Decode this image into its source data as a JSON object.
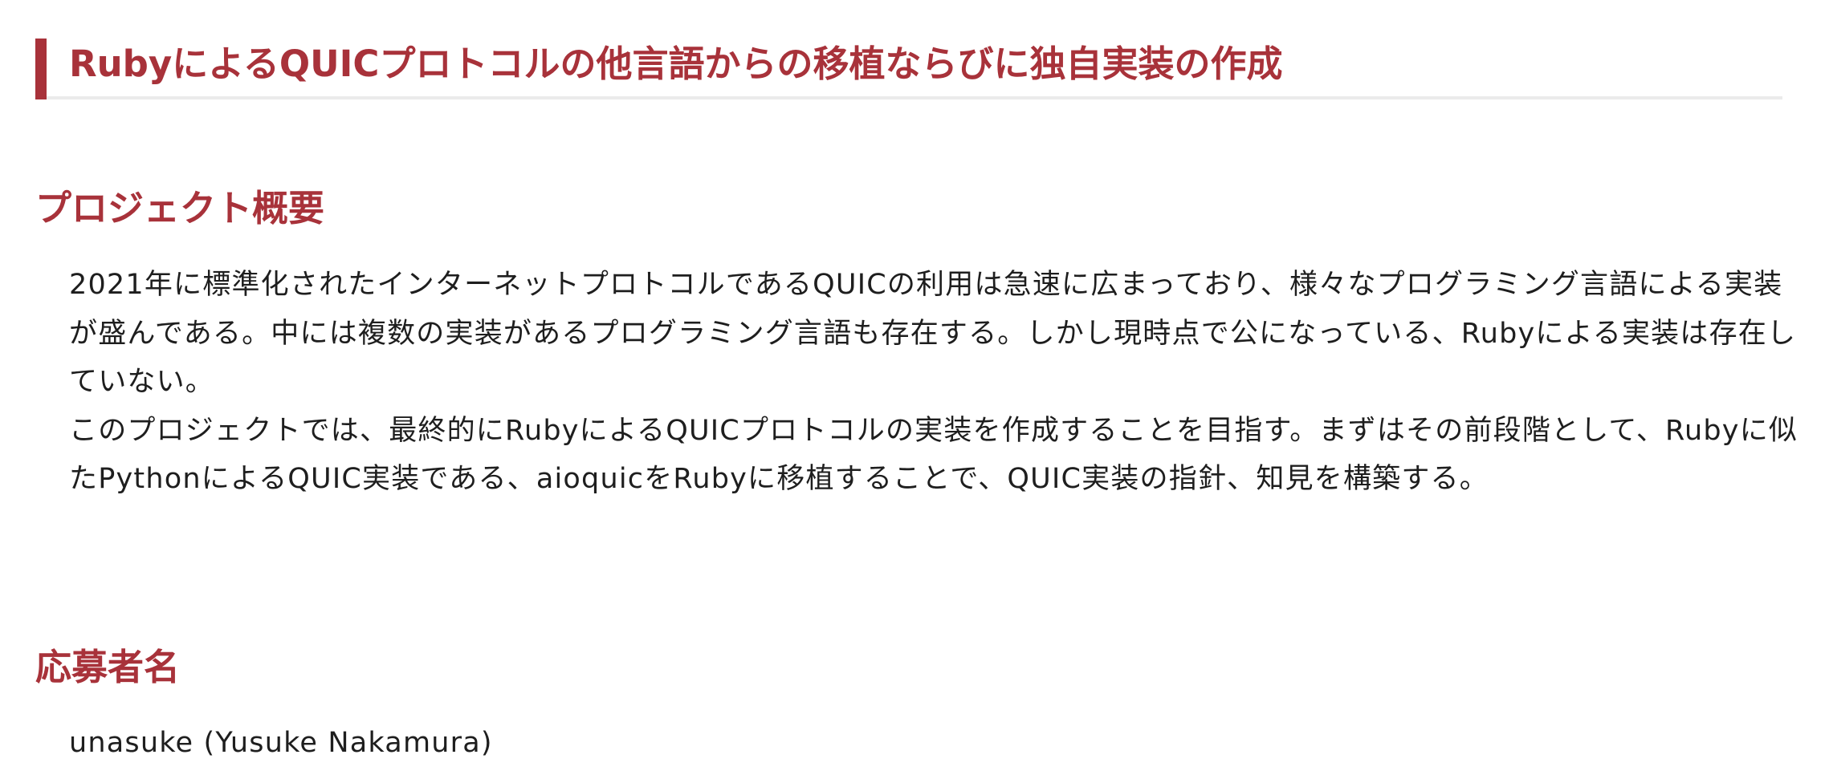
{
  "title": "RubyによるQUICプロトコルの他言語からの移植ならびに独自実装の作成",
  "overview": {
    "heading": "プロジェクト概要",
    "paragraphs": [
      "2021年に標準化されたインターネットプロトコルであるQUICの利用は急速に広まっており、様々なプログラミング言語による実装が盛んである。中には複数の実装があるプログラミング言語も存在する。しかし現時点で公になっている、Rubyによる実装は存在していない。",
      "このプロジェクトでは、最終的にRubyによるQUICプロトコルの実装を作成することを目指す。まずはその前段階として、Rubyに似たPythonによるQUIC実装である、aioquicをRubyに移植することで、QUIC実装の指針、知見を構築する。"
    ]
  },
  "applicant": {
    "heading": "応募者名",
    "name": "unasuke (Yusuke Nakamura)"
  }
}
